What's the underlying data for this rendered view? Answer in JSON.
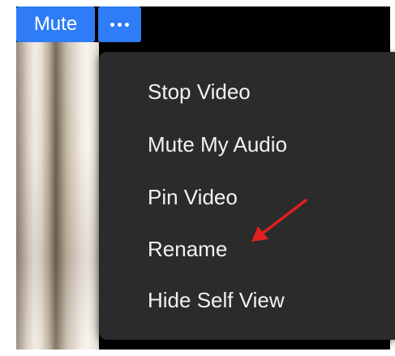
{
  "toolbar": {
    "mute_label": "Mute",
    "more_icon": "more-horizontal-icon"
  },
  "menu": {
    "items": [
      {
        "label": "Stop Video"
      },
      {
        "label": "Mute My Audio"
      },
      {
        "label": "Pin Video"
      },
      {
        "label": "Rename"
      },
      {
        "label": "Hide Self View"
      }
    ]
  },
  "annotation": {
    "icon": "red-arrow-icon",
    "color": "#e02020",
    "points_to": "Rename"
  },
  "colors": {
    "button_blue": "#2e7df6",
    "menu_background": "#2b2b2b",
    "menu_text": "#f2f2f2"
  }
}
